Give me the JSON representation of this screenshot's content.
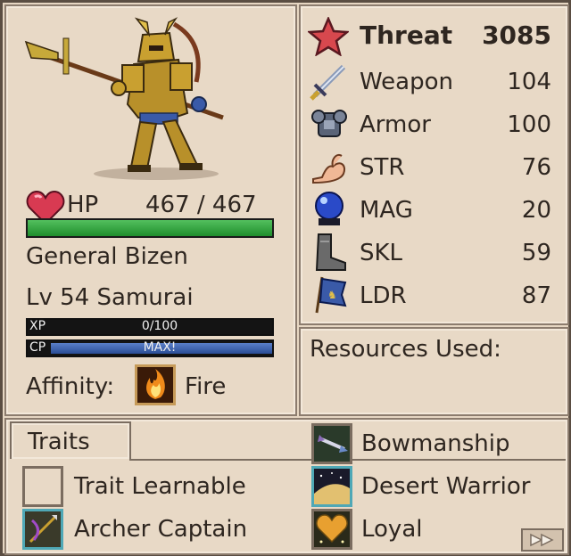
{
  "unit": {
    "hp_label": "HP",
    "hp_text": "467 / 467",
    "hp_fraction": 1.0,
    "name": "General Bizen",
    "level_class": "Lv 54 Samurai",
    "xp_label": "XP",
    "xp_text": "0/100",
    "xp_fraction": 0.0,
    "cp_label": "CP",
    "cp_text": "MAX!",
    "cp_fraction": 1.0,
    "affinity_label": "Affinity:",
    "affinity_value": "Fire",
    "affinity_icon": "fire-icon"
  },
  "stats": {
    "threat_label": "Threat",
    "threat_value": "3085",
    "rows": [
      {
        "label": "Weapon",
        "value": "104",
        "icon": "sword-icon"
      },
      {
        "label": "Armor",
        "value": "100",
        "icon": "armor-icon"
      },
      {
        "label": "STR",
        "value": "76",
        "icon": "arm-muscle-icon"
      },
      {
        "label": "MAG",
        "value": "20",
        "icon": "crystal-ball-icon"
      },
      {
        "label": "SKL",
        "value": "59",
        "icon": "boot-icon"
      },
      {
        "label": "LDR",
        "value": "87",
        "icon": "banner-icon"
      }
    ]
  },
  "resources": {
    "label": "Resources Used:"
  },
  "traits": {
    "tab_label": "Traits",
    "items": [
      {
        "label": "Trait Learnable",
        "icon": "empty-slot",
        "active": false
      },
      {
        "label": "Archer Captain",
        "icon": "archer-icon",
        "active": true
      },
      {
        "label": "Bowmanship",
        "icon": "bow-icon",
        "active": false
      },
      {
        "label": "Desert Warrior",
        "icon": "desert-icon",
        "active": true
      },
      {
        "label": "Loyal",
        "icon": "heart-icon",
        "active": false
      }
    ]
  },
  "colors": {
    "hp_bar": "#2fa63b",
    "cp_bar": "#3b5fae",
    "frame": "#8c7c6e",
    "panel_bg": "#e8d9c6",
    "threat_star": "#d8484e"
  }
}
